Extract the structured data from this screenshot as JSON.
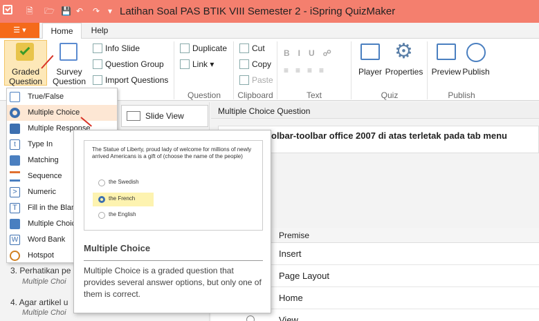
{
  "window": {
    "title": "Latihan Soal PAS BTIK VIII Semester 2 - iSpring QuizMaker"
  },
  "tabs": {
    "file": "",
    "home": "Home",
    "help": "Help"
  },
  "ribbon": {
    "graded": "Graded Question",
    "survey": "Survey Question",
    "info_slide": "Info Slide",
    "question_group": "Question Group",
    "import_questions": "Import Questions",
    "duplicate": "Duplicate",
    "link": "Link",
    "question_group_label": "Question",
    "cut": "Cut",
    "copy": "Copy",
    "paste": "Paste",
    "clipboard_label": "Clipboard",
    "text_label": "Text",
    "player": "Player",
    "properties": "Properties",
    "quiz_label": "Quiz",
    "preview": "Preview",
    "publish": "Publish",
    "publish_label": "Publish"
  },
  "dropdown": {
    "items": [
      "True/False",
      "Multiple Choice",
      "Multiple Response",
      "Type In",
      "Matching",
      "Sequence",
      "Numeric",
      "Fill in the Blanks",
      "Multiple Choice Text",
      "Word Bank",
      "Hotspot"
    ]
  },
  "slide_view": "Slide View",
  "main": {
    "header": "Multiple Choice Question",
    "question": "olbar-toolbar office 2007 di atas terletak pada tab menu",
    "premise_header": "Premise",
    "premises": [
      "Insert",
      "Page Layout",
      "Home",
      "View"
    ]
  },
  "list": [
    {
      "title": "3. Perhatikan pe",
      "sub": "Multiple Choi"
    },
    {
      "title": "4. Agar artikel u",
      "sub": "Multiple Choi"
    }
  ],
  "tooltip": {
    "question": "The Statue of Liberty, proud lady of welcome for millions of newly arrived Americans is a gift of (choose the name of the people)",
    "options": [
      "the Swedish",
      "the French",
      "the English"
    ],
    "title": "Multiple Choice",
    "description": "Multiple Choice is a graded question that provides several answer options, but only one of them is correct."
  }
}
